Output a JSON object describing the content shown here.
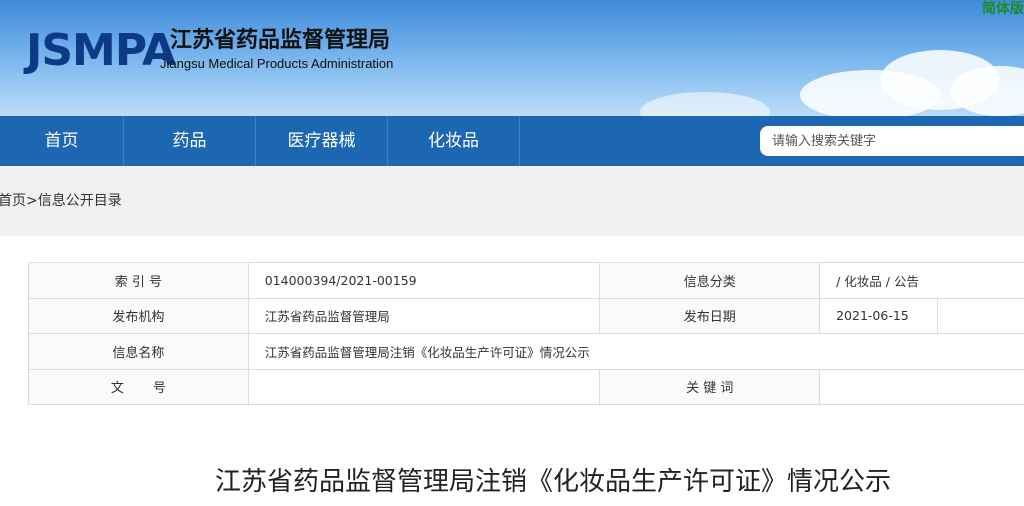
{
  "header": {
    "logo_abbr": "JSMPA",
    "title_cn": "江苏省药品监督管理局",
    "title_en": "Jiangsu Medical Products Administration",
    "lang_switch": "简体版"
  },
  "nav": {
    "items": [
      "首页",
      "药品",
      "医疗器械",
      "化妆品"
    ],
    "search_placeholder": "请输入搜索关键字"
  },
  "breadcrumb": "首页>信息公开目录",
  "info": {
    "index_label": "索 引 号",
    "index_value": "014000394/2021-00159",
    "category_label": "信息分类",
    "category_value": "/   化妆品   /   公告",
    "org_label": "发布机构",
    "org_value": "江苏省药品监督管理局",
    "date_label": "发布日期",
    "date_value": "2021-06-15",
    "name_label": "信息名称",
    "name_value": "江苏省药品监督管理局注销《化妆品生产许可证》情况公示",
    "doc_no_label": "文       号",
    "doc_no_value": "",
    "keyword_label": "关 键 词",
    "keyword_value": ""
  },
  "document": {
    "title": "江苏省药品监督管理局注销《化妆品生产许可证》情况公示"
  },
  "colors": {
    "nav_bg": "#1d67b2",
    "logo": "#0c3a84",
    "lang_switch": "#1f8a2c"
  }
}
